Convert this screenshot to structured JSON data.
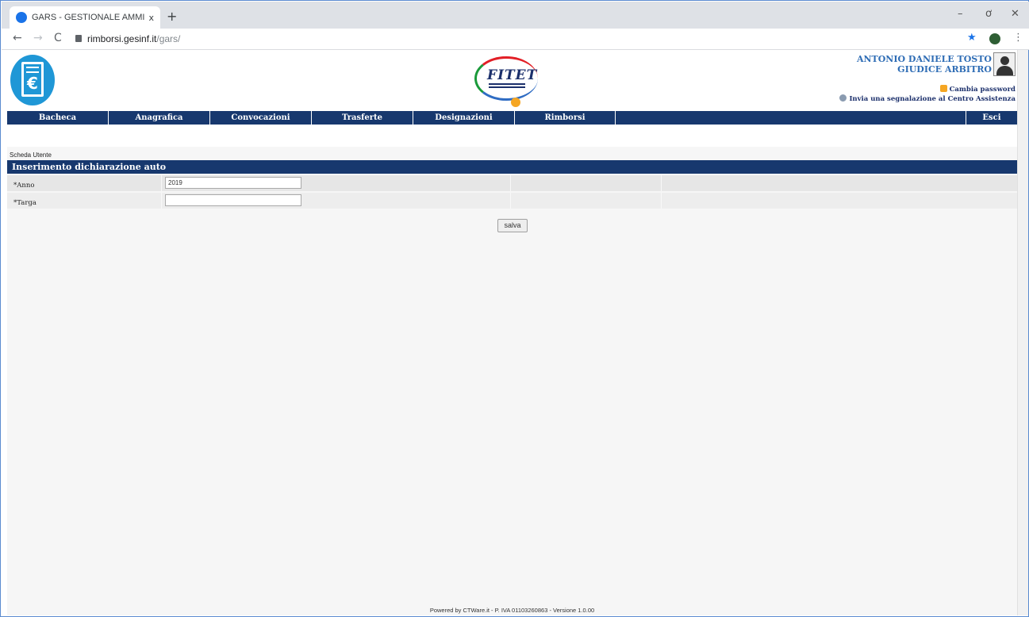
{
  "browser": {
    "tab_title": "GARS - GESTIONALE AMMINISTI",
    "tab_close": "x",
    "new_tab": "+",
    "url_host": "rimborsi.gesinf.it",
    "url_path": "/gars/",
    "minimize": "–",
    "restore": "ơ",
    "close": "✕"
  },
  "header": {
    "logo_symbol": "€",
    "fitet_word": "FITET",
    "user_name": "ANTONIO DANIELE TOSTO",
    "user_role": "GIUDICE ARBITRO",
    "change_password": "Cambia password",
    "support_link": "Invia una segnalazione al Centro Assistenza"
  },
  "menu": {
    "items": [
      {
        "label": "Bacheca"
      },
      {
        "label": "Anagrafica"
      },
      {
        "label": "Convocazioni"
      },
      {
        "label": "Trasferte"
      },
      {
        "label": "Designazioni"
      },
      {
        "label": "Rimborsi"
      }
    ],
    "exit": "Esci"
  },
  "breadcrumb": "Scheda Utente",
  "form": {
    "title": "Inserimento dichiarazione auto",
    "fields": [
      {
        "label": "*Anno",
        "value": "2019"
      },
      {
        "label": "*Targa",
        "value": ""
      }
    ],
    "save_label": "salva"
  },
  "footer": "Powered by CTWare.it - P. IVA 01103260863 - Versione 1.0.00",
  "colors": {
    "nav_blue": "#17386e",
    "logo_blue": "#1f97d6",
    "name_blue": "#2f6db5"
  }
}
